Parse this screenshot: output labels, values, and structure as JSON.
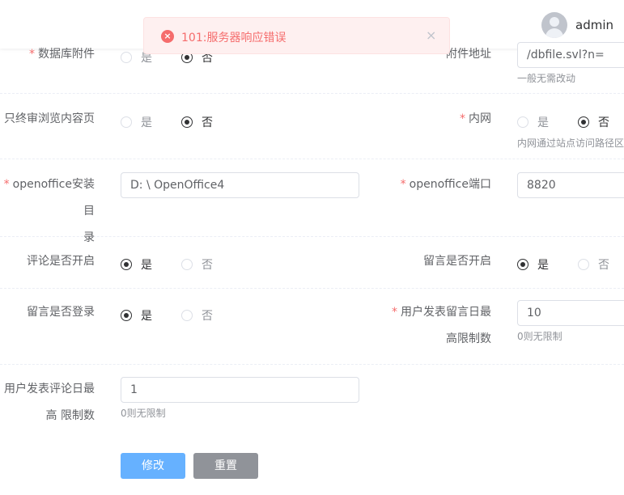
{
  "header": {
    "username": "admin"
  },
  "toast": {
    "message": "101:服务器响应错误",
    "icon": "×",
    "close": "×"
  },
  "form": {
    "attach_label": "数据库附件",
    "attach_yes": "是",
    "attach_no": "否",
    "attach_addr_label": "附件地址",
    "attach_addr_value": "/dbfile.svl?n=",
    "attach_addr_hint": "一般无需改动",
    "audit_label": "只终审浏览内容页",
    "audit_yes": "是",
    "audit_no": "否",
    "intranet_label": "内网",
    "intranet_yes": "是",
    "intranet_no": "否",
    "intranet_hint": "内网通过站点访问路径区",
    "oo_dir_label_1": "openoffice安装目",
    "oo_dir_label_2": "录",
    "oo_dir_value": "D: \\ OpenOffice4",
    "oo_port_label": "openoffice端口",
    "oo_port_value": "8820",
    "comment_open_label": "评论是否开启",
    "comment_open_yes": "是",
    "comment_open_no": "否",
    "msg_open_label": "留言是否开启",
    "msg_open_yes": "是",
    "msg_open_no": "否",
    "msg_login_label": "留言是否登录",
    "msg_login_yes": "是",
    "msg_login_no": "否",
    "msg_limit_label_1": "用户发表留言日最",
    "msg_limit_label_2": "高限制数",
    "msg_limit_value": "10",
    "msg_limit_hint": "0则无限制",
    "comment_limit_label_1": "用户发表评论日最",
    "comment_limit_label_2": "高 限制数",
    "comment_limit_value": "1",
    "comment_limit_hint": "0则无限制",
    "submit": "修改",
    "reset": "重置"
  },
  "colors": {
    "required": "#f56c6c",
    "primary": "#66b1ff",
    "error_bg": "#fef0f0",
    "error": "#f56c6c"
  }
}
